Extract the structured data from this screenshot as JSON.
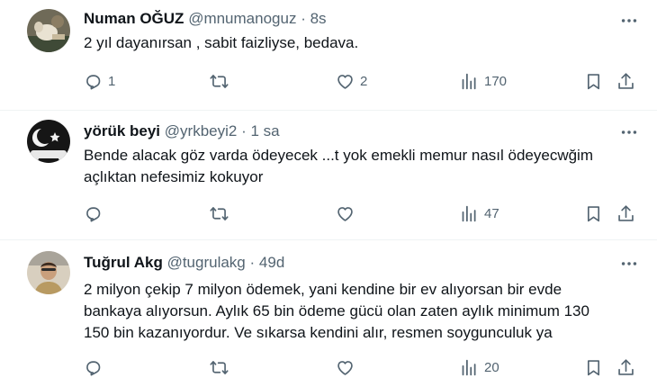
{
  "tweets": [
    {
      "name": "Numan OĞUZ",
      "handle": "@mnumanoguz",
      "dot": "·",
      "time": "8s",
      "text_lines": [
        "2 yıl dayanırsan , sabit faizliyse, bedava."
      ],
      "reply_count": "1",
      "retweet_count": "",
      "like_count": "2",
      "views_count": "170",
      "avatar": "avatar-numan"
    },
    {
      "name": "yörük beyi",
      "handle": "@yrkbeyi2",
      "dot": "·",
      "time": "1 sa",
      "text_lines": [
        "Bende alacak göz varda ödeyecek ...t yok emekli memur nasıl ödeyecwğim",
        "açlıktan nefesimiz kokuyor"
      ],
      "reply_count": "",
      "retweet_count": "",
      "like_count": "",
      "views_count": "47",
      "avatar": "avatar-yoruk"
    },
    {
      "name": "Tuğrul Akg",
      "handle": "@tugrulakg",
      "dot": "·",
      "time": "49d",
      "text_lines": [
        "2 milyon çekip 7 milyon ödemek, yani kendine bir ev alıyorsan bir evde",
        "bankaya alıyorsun. Aylık 65 bin ödeme gücü olan zaten aylık minimum 130",
        "150 bin kazanıyordur. Ve sıkarsa kendini alır, resmen soygunculuk ya"
      ],
      "reply_count": "",
      "retweet_count": "",
      "like_count": "",
      "views_count": "20",
      "avatar": "avatar-tugrul"
    }
  ],
  "icons": {
    "more": "more-icon",
    "reply": "reply-icon",
    "retweet": "retweet-icon",
    "like": "like-icon",
    "views": "views-icon",
    "bookmark": "bookmark-icon",
    "share": "share-icon"
  },
  "colors": {
    "text": "#0f1419",
    "secondary": "#536471",
    "divider": "#eff3f4"
  }
}
